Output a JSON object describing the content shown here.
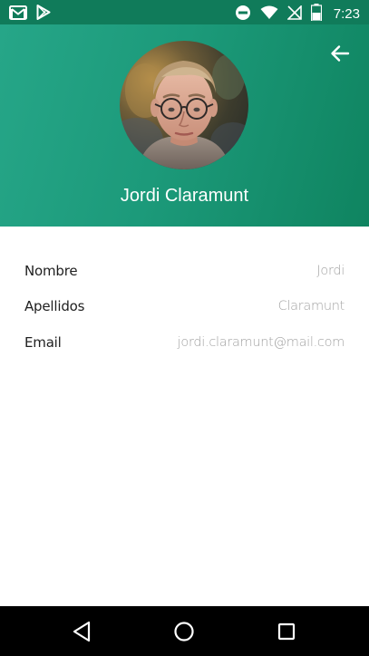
{
  "status_bar": {
    "time": "7:23",
    "icons": [
      "gmail-icon",
      "play-store-icon",
      "do-not-disturb-icon",
      "wifi-icon",
      "no-signal-icon",
      "battery-icon"
    ]
  },
  "header": {
    "name": "Jordi Claramunt",
    "back_icon": "arrow-left-icon",
    "avatar": "profile-photo",
    "colors": {
      "gradient_start": "#26a688",
      "gradient_end": "#0f8460",
      "status_bar": "#107b5a"
    }
  },
  "details": [
    {
      "label": "Nombre",
      "value": "Jordi"
    },
    {
      "label": "Apellidos",
      "value": "Claramunt"
    },
    {
      "label": "Email",
      "value": "jordi.claramunt@mail.com"
    }
  ],
  "nav_bar": {
    "buttons": [
      "back-triangle-icon",
      "home-circle-icon",
      "recents-square-icon"
    ]
  }
}
